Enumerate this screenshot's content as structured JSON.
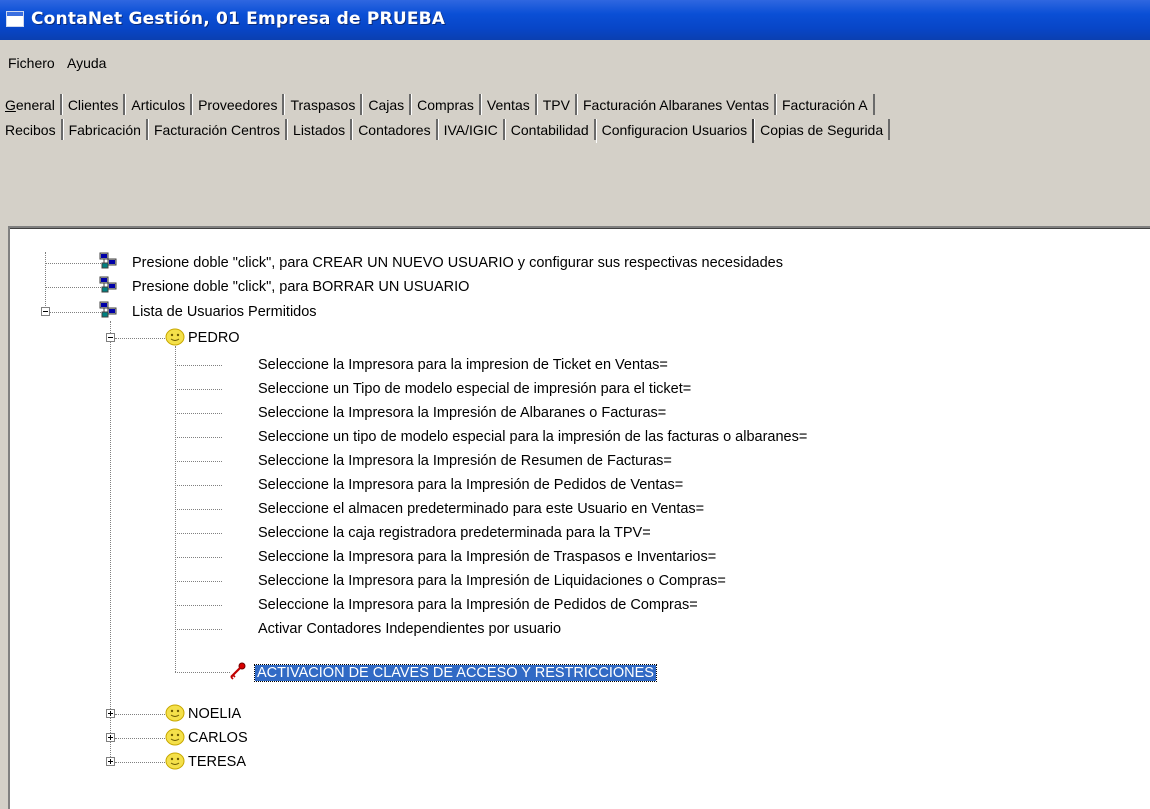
{
  "window": {
    "title": "ContaNet Gestión, 01 Empresa de PRUEBA"
  },
  "menu": {
    "items": [
      "Fichero",
      "Ayuda"
    ]
  },
  "tabs": {
    "row1": [
      "General",
      "Clientes",
      "Articulos",
      "Proveedores",
      "Traspasos",
      "Cajas",
      "Compras",
      "Ventas",
      "TPV",
      "Facturación Albaranes Ventas",
      "Facturación A"
    ],
    "row2": [
      "Recibos",
      "Fabricación",
      "Facturación Centros",
      "Listados",
      "Contadores",
      "IVA/IGIC",
      "Contabilidad",
      "Configuracion Usuarios",
      "Copias de Segurida"
    ],
    "active": "Configuracion Usuarios"
  },
  "tree": {
    "root_items": [
      "Presione doble \"click\", para CREAR UN NUEVO USUARIO y configurar sus respectivas necesidades",
      "Presione doble \"click\", para BORRAR UN USUARIO",
      "Lista de Usuarios Permitidos"
    ],
    "users": [
      "PEDRO",
      "NOELIA",
      "CARLOS",
      "TERESA"
    ],
    "expanded_user": "PEDRO",
    "pedro_options": [
      "Seleccione  la Impresora para la impresion de Ticket en Ventas=",
      "Seleccione un Tipo de modelo especial de impresión para el ticket=",
      "Seleccione la Impresora la Impresión de Albaranes o Facturas=",
      "Seleccione un tipo de modelo especial para la impresión de las facturas o albaranes=",
      "Seleccione la Impresora la Impresión de Resumen de Facturas=",
      "Seleccione la Impresora para la Impresión de Pedidos de Ventas=",
      "Seleccione el almacen predeterminado para este Usuario en Ventas=",
      "Seleccione la caja registradora predeterminada para la TPV=",
      "Seleccione la Impresora para la Impresión de Traspasos e Inventarios=",
      "Seleccione la Impresora para la Impresión de Liquidaciones o Compras=",
      "Seleccione la Impresora para la Impresión de Pedidos de Compras=",
      "Activar Contadores Independientes por usuario"
    ],
    "selected_item": "ACTIVACIÓN DE CLAVES DE ACCESO Y RESTRICCIONES"
  },
  "colors": {
    "titlebar": "#0a4fd6",
    "selection": "#316ac5",
    "user_icon": "#f4e04a"
  },
  "icons": {
    "network": "network-computers-icon",
    "user": "smiley-user-icon",
    "key": "red-key-icon"
  }
}
